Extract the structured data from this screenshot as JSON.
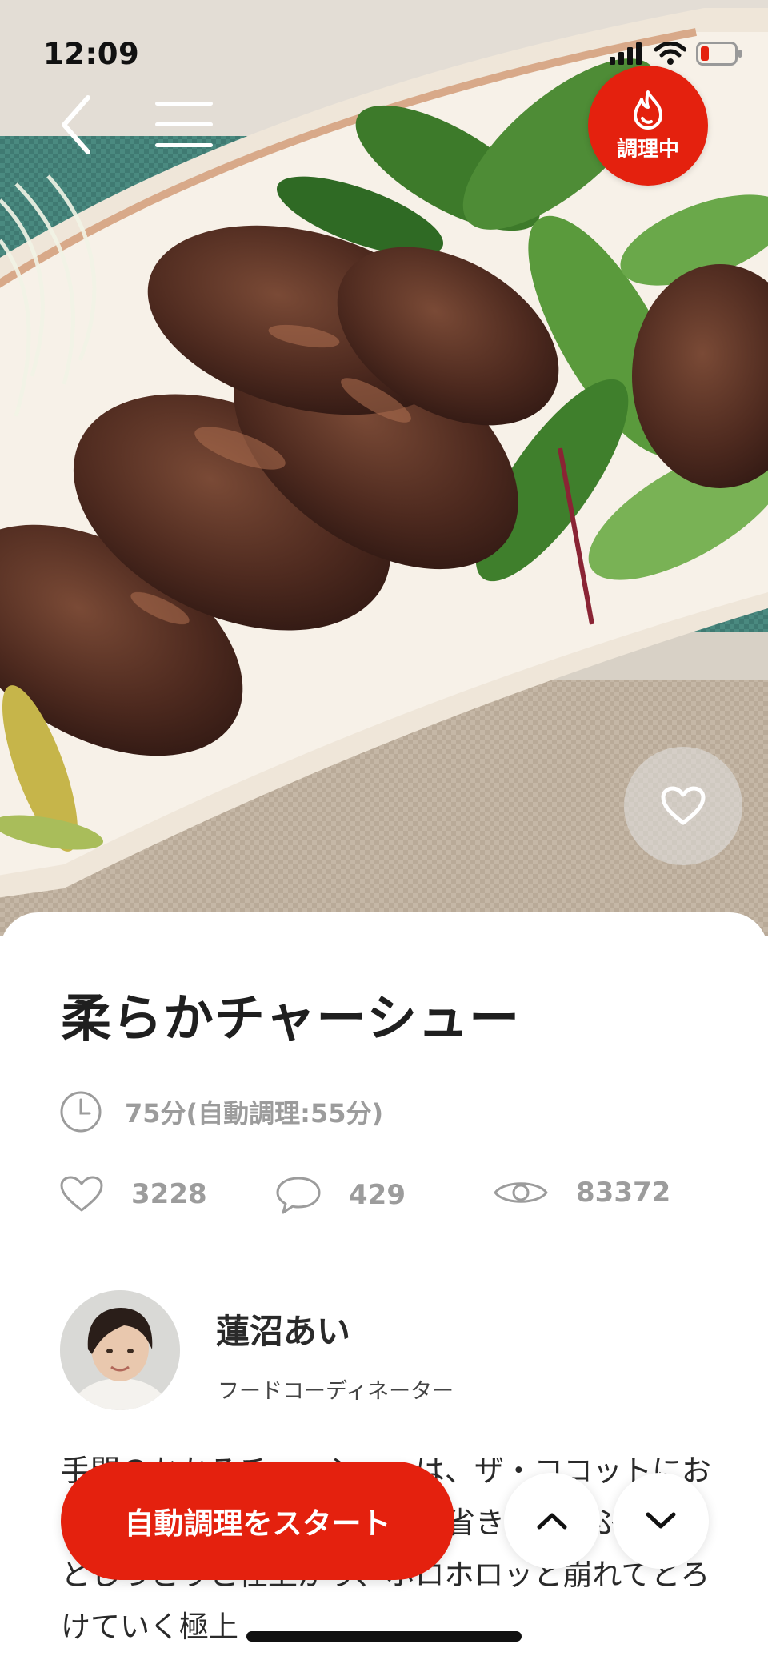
{
  "status_bar": {
    "time": "12:09"
  },
  "nav": {
    "back_icon": "chevron-left-icon",
    "menu_icon": "hamburger-menu-icon",
    "cooking_badge_label": "調理中",
    "cooking_badge_icon": "flame-icon",
    "favorite_icon": "heart-icon"
  },
  "recipe": {
    "title": "柔らかチャーシュー",
    "time_text": "75分(自動調理:55分)",
    "stats": {
      "likes": "3228",
      "comments": "429",
      "views": "83372"
    },
    "author": {
      "name": "蓮沼あい",
      "role": "フードコーディネーター"
    },
    "description": "手間のかかるチャーシューは、ザ・ココットにおまかせ。下ごしらえの手間も省きます。ふっくらとしっとりと仕上がり、ホロホロッと崩れてとろけていく極上"
  },
  "actions": {
    "start_label": "自動調理をスタート",
    "up_icon": "chevron-up-icon",
    "down_icon": "chevron-down-icon"
  },
  "colors": {
    "accent": "#e4210e",
    "muted_text": "#9c9c9c",
    "title_text": "#1f1f1f"
  }
}
